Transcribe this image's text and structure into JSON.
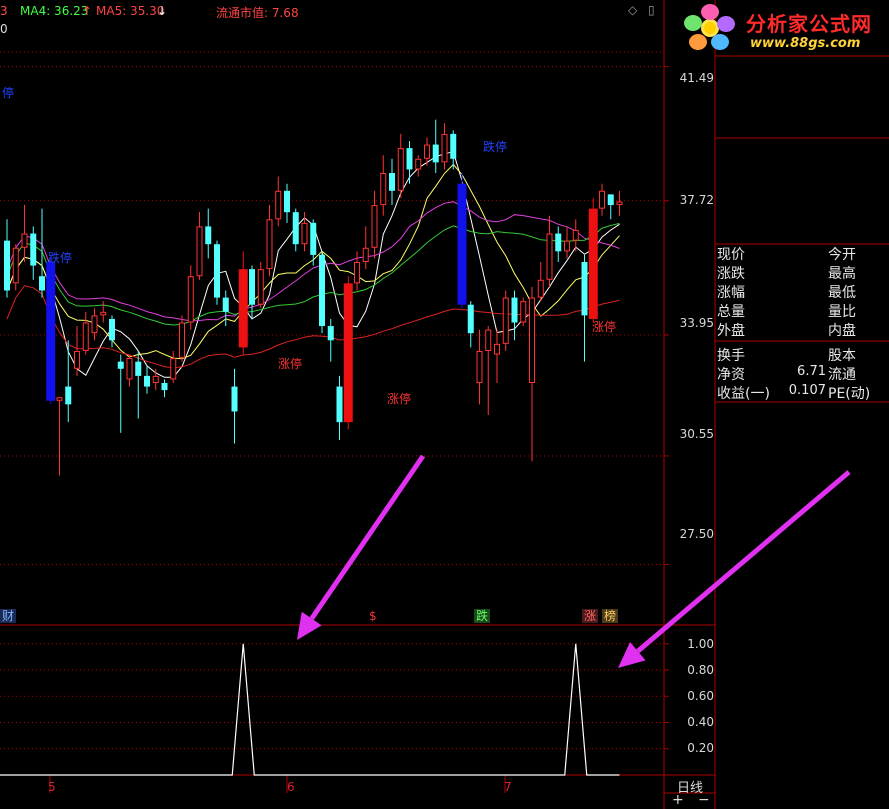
{
  "topbar": {
    "ma_left_partial": "3",
    "ma4_label": "MA4: 36.23",
    "ma4_arrow": "↑",
    "ma5_label": "MA5: 35.30",
    "ma5_arrow": "↓",
    "market_value": "流通市值: 7.68",
    "zero_marker": "0"
  },
  "logo": {
    "title": "分析家公式网",
    "url": "www.88gs.com"
  },
  "price_axis": [
    "41.49",
    "37.72",
    "33.95",
    "30.55",
    "27.50"
  ],
  "indicator_axis": [
    "1.00",
    "0.80",
    "0.60",
    "0.40",
    "0.20"
  ],
  "chart_annotations": {
    "limit_down_1": "跌停",
    "limit_down_2": "跌停",
    "limit_down_left_partial": "停",
    "limit_up_1": "涨停",
    "limit_up_2": "涨停",
    "limit_up_3": "涨停"
  },
  "event_markers": {
    "cai": "财",
    "dollar": "$",
    "die": "跌",
    "zhang": "涨",
    "bang": "榜"
  },
  "dates": [
    "5",
    "6",
    "7"
  ],
  "quote_panel": {
    "rows": [
      {
        "l": "现价",
        "v": "",
        "r": "今开"
      },
      {
        "l": "涨跌",
        "v": "",
        "r": "最高"
      },
      {
        "l": "涨幅",
        "v": "",
        "r": "最低"
      },
      {
        "l": "总量",
        "v": "",
        "r": "量比"
      },
      {
        "l": "外盘",
        "v": "",
        "r": "内盘"
      },
      {
        "l": "换手",
        "v": "",
        "r": "股本"
      },
      {
        "l": "净资",
        "v": "6.71",
        "r": "流通"
      },
      {
        "l": "收益(一)",
        "v": "0.107",
        "r": "PE(动)"
      }
    ]
  },
  "bottom_bar": {
    "period": "日线",
    "plus": "+",
    "minus": "−"
  },
  "colors": {
    "up": "#ff3333",
    "down_cyan": "#54ffff",
    "limit_up": "#ee1111",
    "limit_down": "#1111ee",
    "ma_white": "#ffffff",
    "ma_yellow": "#ffff66",
    "ma_magenta": "#e040e0",
    "ma_green": "#33cc33",
    "ma_red": "#dd2222",
    "arrow": "#e030f0",
    "grid": "#b00000"
  },
  "chart_data": {
    "type": "candlestick",
    "ylim": [
      25.8,
      42.8
    ],
    "ticks": [
      41.49,
      37.72,
      33.95,
      30.55,
      27.5
    ],
    "candles": [
      {
        "o": 36.6,
        "h": 37.2,
        "c": 35.2,
        "l": 35.0
      },
      {
        "o": 35.4,
        "h": 36.5,
        "c": 36.4,
        "l": 35.2
      },
      {
        "o": 36.4,
        "h": 37.6,
        "c": 36.8,
        "l": 36.0
      },
      {
        "o": 36.8,
        "h": 37.0,
        "c": 35.9,
        "l": 35.5
      },
      {
        "o": 35.6,
        "h": 37.5,
        "c": 35.2,
        "l": 35.0
      },
      {
        "o": 36.0,
        "h": 36.2,
        "c": 32.1,
        "l": 32.0,
        "t": "ld"
      },
      {
        "o": 32.1,
        "h": 32.2,
        "c": 32.2,
        "l": 30.0
      },
      {
        "o": 32.5,
        "h": 33.8,
        "c": 32.0,
        "l": 31.5
      },
      {
        "o": 33.0,
        "h": 34.2,
        "c": 33.5,
        "l": 32.8
      },
      {
        "o": 33.5,
        "h": 34.6,
        "c": 34.3,
        "l": 33.4
      },
      {
        "o": 34.0,
        "h": 34.7,
        "c": 34.5,
        "l": 33.8
      },
      {
        "o": 34.5,
        "h": 34.9,
        "c": 34.6,
        "l": 34.3
      },
      {
        "o": 34.4,
        "h": 34.5,
        "c": 33.8,
        "l": 33.6
      },
      {
        "o": 33.2,
        "h": 33.4,
        "c": 33.0,
        "l": 31.2
      },
      {
        "o": 32.7,
        "h": 33.4,
        "c": 33.3,
        "l": 32.5
      },
      {
        "o": 33.2,
        "h": 33.5,
        "c": 32.8,
        "l": 31.6
      },
      {
        "o": 32.8,
        "h": 33.1,
        "c": 32.5,
        "l": 32.3
      },
      {
        "o": 32.6,
        "h": 33.0,
        "c": 32.8,
        "l": 32.4
      },
      {
        "o": 32.6,
        "h": 32.7,
        "c": 32.4,
        "l": 32.2
      },
      {
        "o": 32.7,
        "h": 33.5,
        "c": 33.3,
        "l": 32.6
      },
      {
        "o": 33.3,
        "h": 34.5,
        "c": 34.3,
        "l": 33.2
      },
      {
        "o": 34.3,
        "h": 35.9,
        "c": 35.6,
        "l": 34.1
      },
      {
        "o": 35.6,
        "h": 37.4,
        "c": 37.0,
        "l": 35.5
      },
      {
        "o": 37.0,
        "h": 37.5,
        "c": 36.5,
        "l": 36.1
      },
      {
        "o": 36.5,
        "h": 36.6,
        "c": 35.0,
        "l": 34.8
      },
      {
        "o": 35.0,
        "h": 35.2,
        "c": 34.6,
        "l": 34.2
      },
      {
        "o": 32.5,
        "h": 33.0,
        "c": 31.8,
        "l": 30.9
      },
      {
        "o": 33.6,
        "h": 36.3,
        "c": 35.8,
        "l": 33.4,
        "t": "lu"
      },
      {
        "o": 35.8,
        "h": 35.9,
        "c": 34.8,
        "l": 34.4
      },
      {
        "o": 34.8,
        "h": 36.0,
        "c": 35.8,
        "l": 34.7
      },
      {
        "o": 35.8,
        "h": 37.6,
        "c": 37.2,
        "l": 35.6
      },
      {
        "o": 37.2,
        "h": 38.4,
        "c": 38.0,
        "l": 37.0
      },
      {
        "o": 38.0,
        "h": 38.2,
        "c": 37.4,
        "l": 37.1
      },
      {
        "o": 37.4,
        "h": 37.5,
        "c": 36.5,
        "l": 36.3
      },
      {
        "o": 36.5,
        "h": 37.4,
        "c": 37.1,
        "l": 36.3
      },
      {
        "o": 37.1,
        "h": 37.2,
        "c": 36.2,
        "l": 35.9
      },
      {
        "o": 36.2,
        "h": 36.3,
        "c": 34.2,
        "l": 34.0
      },
      {
        "o": 34.2,
        "h": 34.4,
        "c": 33.8,
        "l": 33.2
      },
      {
        "o": 32.5,
        "h": 32.8,
        "c": 31.5,
        "l": 31.0
      },
      {
        "o": 31.5,
        "h": 35.6,
        "c": 35.4,
        "l": 31.3,
        "t": "lu"
      },
      {
        "o": 35.4,
        "h": 36.3,
        "c": 36.0,
        "l": 35.2
      },
      {
        "o": 36.0,
        "h": 37.0,
        "c": 36.4,
        "l": 35.8
      },
      {
        "o": 36.4,
        "h": 38.0,
        "c": 37.6,
        "l": 36.1
      },
      {
        "o": 37.6,
        "h": 39.0,
        "c": 38.5,
        "l": 37.3
      },
      {
        "o": 38.5,
        "h": 38.9,
        "c": 38.0,
        "l": 37.6
      },
      {
        "o": 38.0,
        "h": 39.6,
        "c": 39.2,
        "l": 37.8
      },
      {
        "o": 39.2,
        "h": 39.4,
        "c": 38.6,
        "l": 38.2
      },
      {
        "o": 38.6,
        "h": 39.0,
        "c": 38.9,
        "l": 38.4
      },
      {
        "o": 38.9,
        "h": 39.5,
        "c": 39.3,
        "l": 38.7
      },
      {
        "o": 39.3,
        "h": 40.0,
        "c": 38.8,
        "l": 38.5
      },
      {
        "o": 38.8,
        "h": 39.9,
        "c": 39.6,
        "l": 38.6
      },
      {
        "o": 39.6,
        "h": 39.7,
        "c": 38.9,
        "l": 38.6
      },
      {
        "o": 38.2,
        "h": 38.5,
        "c": 34.8,
        "l": 34.7,
        "t": "ld"
      },
      {
        "o": 34.8,
        "h": 34.9,
        "c": 34.0,
        "l": 33.6
      },
      {
        "o": 32.6,
        "h": 34.1,
        "c": 33.5,
        "l": 32.0
      },
      {
        "o": 33.5,
        "h": 34.2,
        "c": 34.1,
        "l": 31.7
      },
      {
        "o": 33.4,
        "h": 34.1,
        "c": 33.7,
        "l": 32.6
      },
      {
        "o": 33.7,
        "h": 35.2,
        "c": 35.0,
        "l": 33.5
      },
      {
        "o": 35.0,
        "h": 35.2,
        "c": 34.3,
        "l": 33.8
      },
      {
        "o": 34.3,
        "h": 35.0,
        "c": 34.9,
        "l": 34.2
      },
      {
        "o": 32.6,
        "h": 35.3,
        "c": 35.0,
        "l": 30.4
      },
      {
        "o": 35.0,
        "h": 36.0,
        "c": 35.5,
        "l": 34.9
      },
      {
        "o": 35.5,
        "h": 37.3,
        "c": 36.8,
        "l": 35.3
      },
      {
        "o": 36.8,
        "h": 37.0,
        "c": 36.3,
        "l": 36.0
      },
      {
        "o": 36.3,
        "h": 37.0,
        "c": 36.6,
        "l": 36.1
      },
      {
        "o": 36.6,
        "h": 37.2,
        "c": 36.9,
        "l": 36.3
      },
      {
        "o": 36.0,
        "h": 36.2,
        "c": 34.5,
        "l": 33.2
      },
      {
        "o": 34.4,
        "h": 37.8,
        "c": 37.5,
        "l": 34.3,
        "t": "lu"
      },
      {
        "o": 37.5,
        "h": 38.2,
        "c": 38.0,
        "l": 37.3
      },
      {
        "o": 37.9,
        "h": 37.9,
        "c": 37.6,
        "l": 37.2
      },
      {
        "o": 37.6,
        "h": 38.0,
        "c": 37.7,
        "l": 37.3
      }
    ],
    "indicator": {
      "ylim": [
        0,
        1.12
      ],
      "spikes": [
        {
          "center_index": 27,
          "value": 1.0
        },
        {
          "center_index": 65,
          "value": 1.0
        }
      ]
    }
  }
}
